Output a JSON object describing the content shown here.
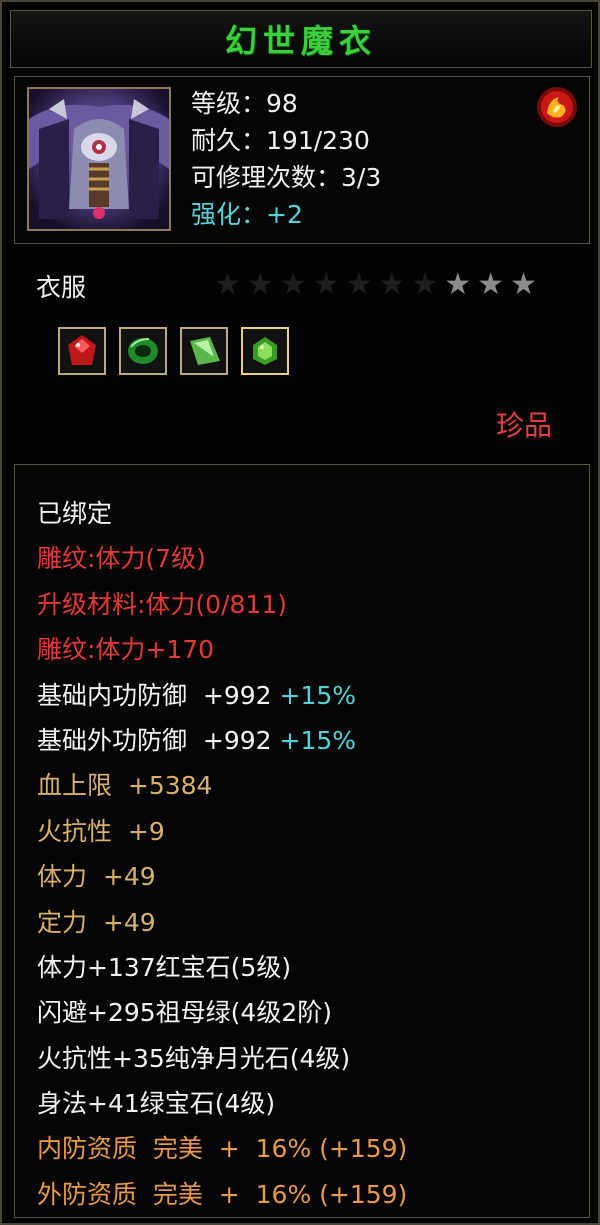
{
  "item": {
    "name": "幻世魔衣",
    "level_label": "等级：",
    "level_value": "98",
    "durability_label": "耐久：",
    "durability_value": "191/230",
    "repair_label": "可修理次数：",
    "repair_value": "3/3",
    "enhance_label": "强化：",
    "enhance_value": "+2",
    "type": "衣服",
    "stars_total": 10,
    "stars_on": 3,
    "rarity": "珍品"
  },
  "icons": {
    "portrait": "armor-portrait-icon",
    "badge": "red-fire-emblem-icon",
    "gems": [
      "ruby-gem-icon",
      "emerald-ring-gem-icon",
      "green-crystal-gem-icon",
      "peridot-gem-icon"
    ]
  },
  "attributes": [
    {
      "text": "已绑定",
      "color": "#f2f2f2"
    },
    {
      "text": "雕纹:体力(7级)",
      "color": "#e23a36"
    },
    {
      "text": "升级材料:体力(0/811)",
      "color": "#e23a36"
    },
    {
      "text": "雕纹:体力+170",
      "color": "#e23a36"
    },
    {
      "text": "基础内功防御  +992",
      "extra": " +15%",
      "color": "#f2f2f2"
    },
    {
      "text": "基础外功防御  +992",
      "extra": " +15%",
      "color": "#f2f2f2"
    },
    {
      "text": "血上限  +5384",
      "color": "#d8b06a"
    },
    {
      "text": "火抗性  +9",
      "color": "#d8b06a"
    },
    {
      "text": "体力  +49",
      "color": "#d8b06a"
    },
    {
      "text": "定力  +49",
      "color": "#d8b06a"
    },
    {
      "text": "体力+137红宝石(5级)",
      "color": "#f2f2f2"
    },
    {
      "text": "闪避+295祖母绿(4级2阶)",
      "color": "#f2f2f2"
    },
    {
      "text": "火抗性+35纯净月光石(4级)",
      "color": "#f2f2f2"
    },
    {
      "text": "身法+41绿宝石(4级)",
      "color": "#f2f2f2"
    },
    {
      "text": "内防资质  完美  +  16% (+159)",
      "color": "#e79a48"
    },
    {
      "text": "外防资质  完美  +  16% (+159)",
      "color": "#e79a48"
    }
  ],
  "colors": {
    "title_green": "#3ccf3c",
    "enhance_cyan": "#53d3d9",
    "rarity_red": "#e04040",
    "border": "#5a5544"
  }
}
